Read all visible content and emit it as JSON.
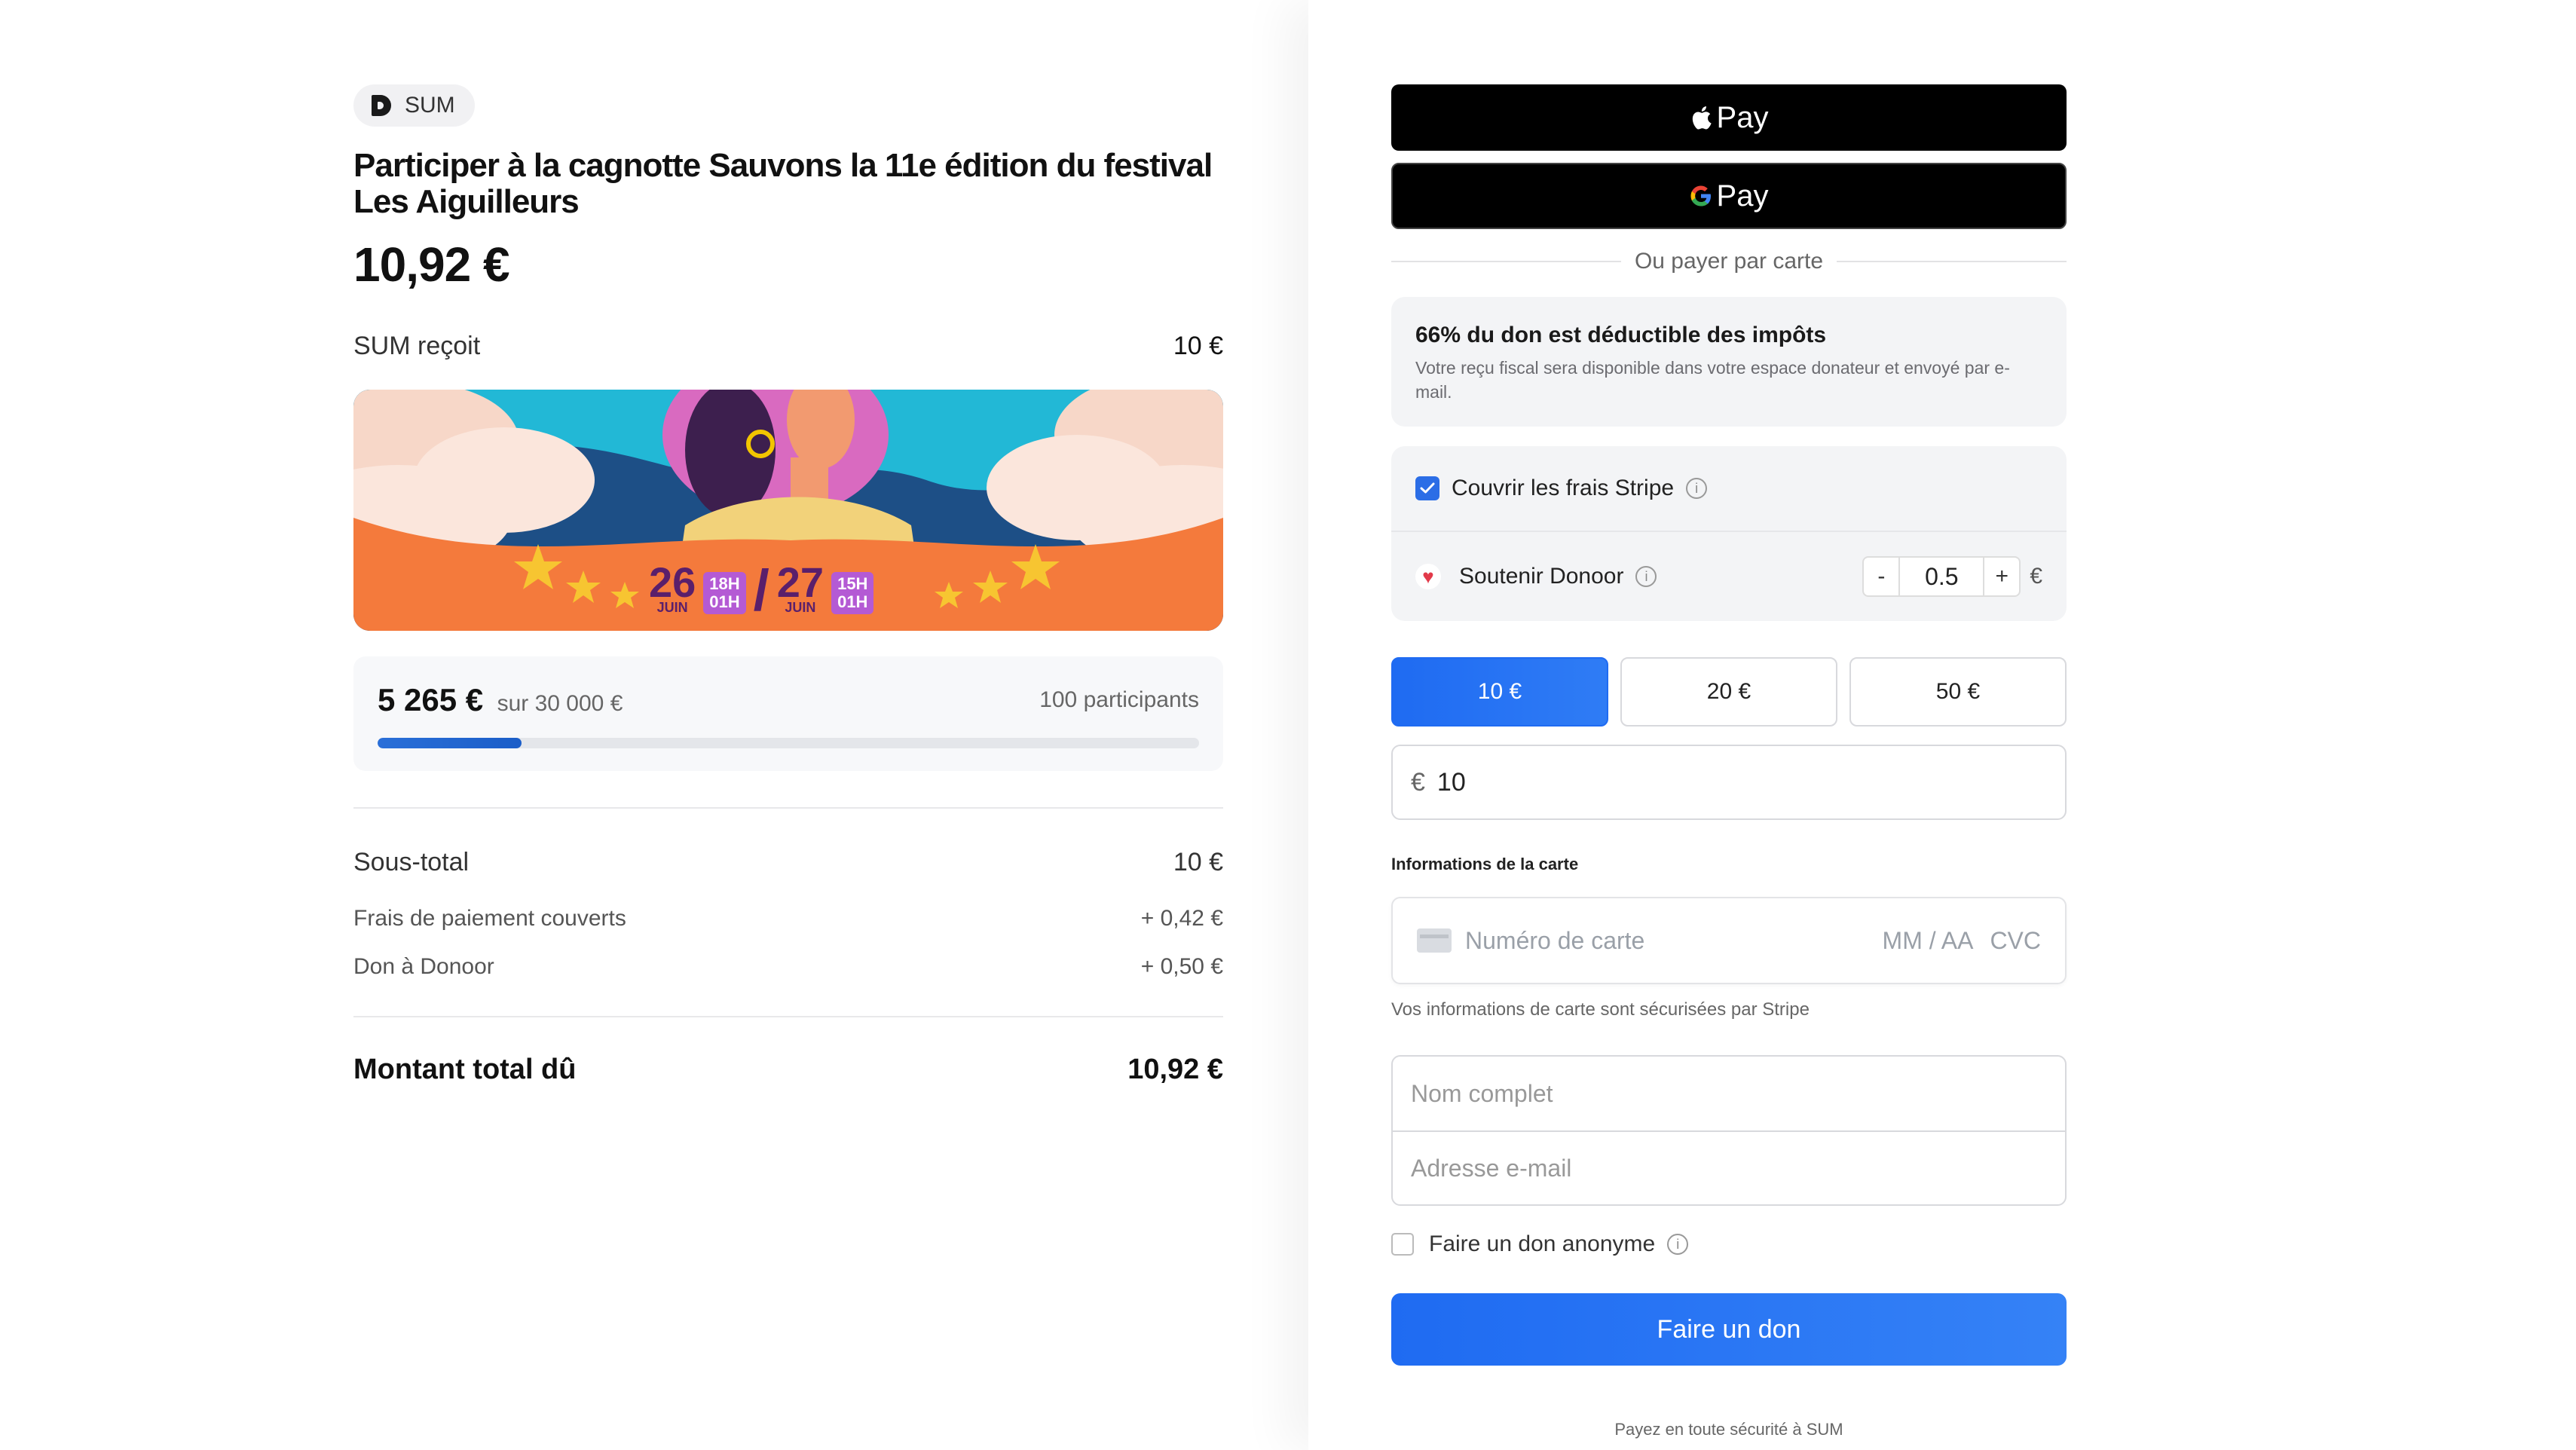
{
  "left": {
    "org": {
      "name": "SUM"
    },
    "title": "Participer à la cagnotte Sauvons la 11e édition du festival Les Aiguilleurs",
    "amount": "10,92 €",
    "receives": {
      "label": "SUM reçoit",
      "value": "10 €"
    },
    "banner": {
      "text1": "26",
      "sub1": "JUIN",
      "time1a": "18H",
      "time1b": "01H",
      "text2": "27",
      "sub2": "JUIN",
      "time2a": "15H",
      "time2b": "01H",
      "slash": "/"
    },
    "progress": {
      "raised": "5 265 €",
      "goal": "sur 30 000 €",
      "participants": "100 participants",
      "fraction": 0.1755
    },
    "summary": {
      "subtotal_label": "Sous-total",
      "subtotal_value": "10 €",
      "fees_label": "Frais de paiement couverts",
      "fees_value": "+ 0,42 €",
      "donoor_label": "Don à Donoor",
      "donoor_value": "+ 0,50 €",
      "total_label": "Montant total dû",
      "total_value": "10,92 €"
    }
  },
  "right": {
    "apple_pay": "Pay",
    "google_pay": "Pay",
    "divider": "Ou payer par carte",
    "tax": {
      "title": "66% du don est déductible des impôts",
      "text": "Votre reçu fiscal sera disponible dans votre espace donateur et envoyé par e-mail."
    },
    "cover_fees": {
      "label": "Couvrir les frais Stripe",
      "checked": true
    },
    "donoor": {
      "label": "Soutenir Donoor",
      "minus": "-",
      "value": "0.5",
      "plus": "+",
      "currency": "€"
    },
    "amounts": [
      "10 €",
      "20 €",
      "50 €"
    ],
    "selected_amount_index": 0,
    "custom": {
      "currency": "€",
      "value": "10"
    },
    "card_label": "Informations de la carte",
    "card": {
      "number_placeholder": "Numéro de carte",
      "exp": "MM / AA",
      "cvc": "CVC"
    },
    "secure_text": "Vos informations de carte sont sécurisées par Stripe",
    "name_placeholder": "Nom complet",
    "email_placeholder": "Adresse e-mail",
    "anonymous": {
      "label": "Faire un don anonyme",
      "checked": false
    },
    "submit": "Faire un don",
    "footer": "Payez en toute sécurité à SUM"
  },
  "colors": {
    "accent": "#1f6bf2",
    "banner_orange": "#f47a3c",
    "banner_blue": "#2f5b8c"
  }
}
